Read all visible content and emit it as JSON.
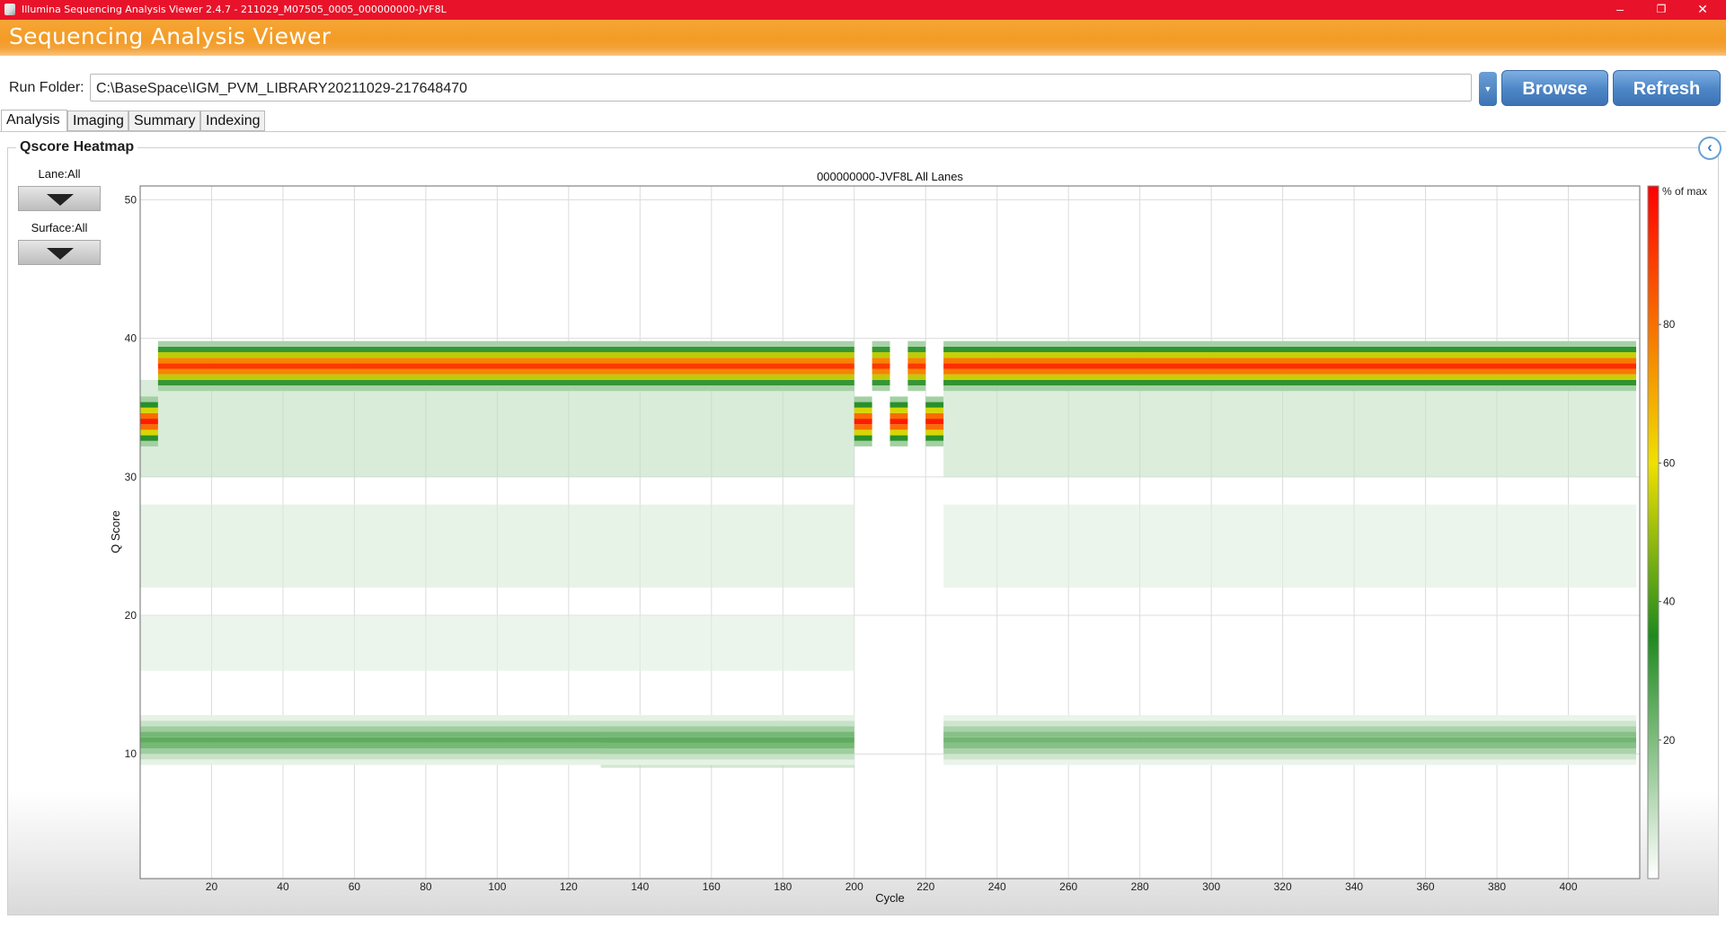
{
  "window": {
    "title": "Illumina Sequencing Analysis Viewer 2.4.7 - 211029_M07505_0005_000000000-JVF8L",
    "minimize": "–",
    "restore": "❐",
    "close": "✕"
  },
  "banner": {
    "title": "Sequencing Analysis Viewer"
  },
  "run_folder": {
    "label": "Run Folder:",
    "value": "C:\\BaseSpace\\IGM_PVM_LIBRARY20211029-217648470",
    "dropdown_icon": "chevron-down"
  },
  "buttons": {
    "browse": "Browse",
    "refresh": "Refresh"
  },
  "tabs": [
    {
      "label": "Analysis",
      "active": true
    },
    {
      "label": "Imaging",
      "active": false
    },
    {
      "label": "Summary",
      "active": false
    },
    {
      "label": "Indexing",
      "active": false
    }
  ],
  "panel": {
    "title": "Qscore Heatmap",
    "collapse_icon": "chevron-left",
    "lane_label": "Lane:All",
    "surface_label": "Surface:All"
  },
  "chart_data": {
    "type": "heatmap",
    "title": "000000000-JVF8L All Lanes",
    "xlabel": "Cycle",
    "ylabel": "Q Score",
    "xlim": [
      0,
      420
    ],
    "ylim": [
      1,
      51
    ],
    "x_ticks": [
      20,
      40,
      60,
      80,
      100,
      120,
      140,
      160,
      180,
      200,
      220,
      240,
      260,
      280,
      300,
      320,
      340,
      360,
      380,
      400
    ],
    "y_ticks": [
      10,
      20,
      30,
      40,
      50
    ],
    "grid": true,
    "colorbar": {
      "label": "% of max",
      "ticks": [
        20,
        40,
        60,
        80
      ],
      "range": [
        0,
        100
      ],
      "colors": [
        "#ffffff",
        "#1e8a1e",
        "#f0e000",
        "#ff0000"
      ]
    },
    "bands": [
      {
        "cycles": [
          6,
          200
        ],
        "qscore": 38,
        "peak_percent": 90
      },
      {
        "cycles": [
          206,
          210
        ],
        "qscore": 38,
        "peak_percent": 90
      },
      {
        "cycles": [
          216,
          220
        ],
        "qscore": 38,
        "peak_percent": 90
      },
      {
        "cycles": [
          226,
          419
        ],
        "qscore": 38,
        "peak_percent": 92
      },
      {
        "cycles": [
          1,
          5
        ],
        "qscore": 34,
        "peak_percent": 95
      },
      {
        "cycles": [
          201,
          205
        ],
        "qscore": 34,
        "peak_percent": 95
      },
      {
        "cycles": [
          211,
          215
        ],
        "qscore": 34,
        "peak_percent": 95
      },
      {
        "cycles": [
          221,
          225
        ],
        "qscore": 34,
        "peak_percent": 95
      },
      {
        "cycles": [
          1,
          200
        ],
        "qscore": 11,
        "peak_percent": 25
      },
      {
        "cycles": [
          226,
          419
        ],
        "qscore": 11,
        "peak_percent": 22
      }
    ]
  }
}
